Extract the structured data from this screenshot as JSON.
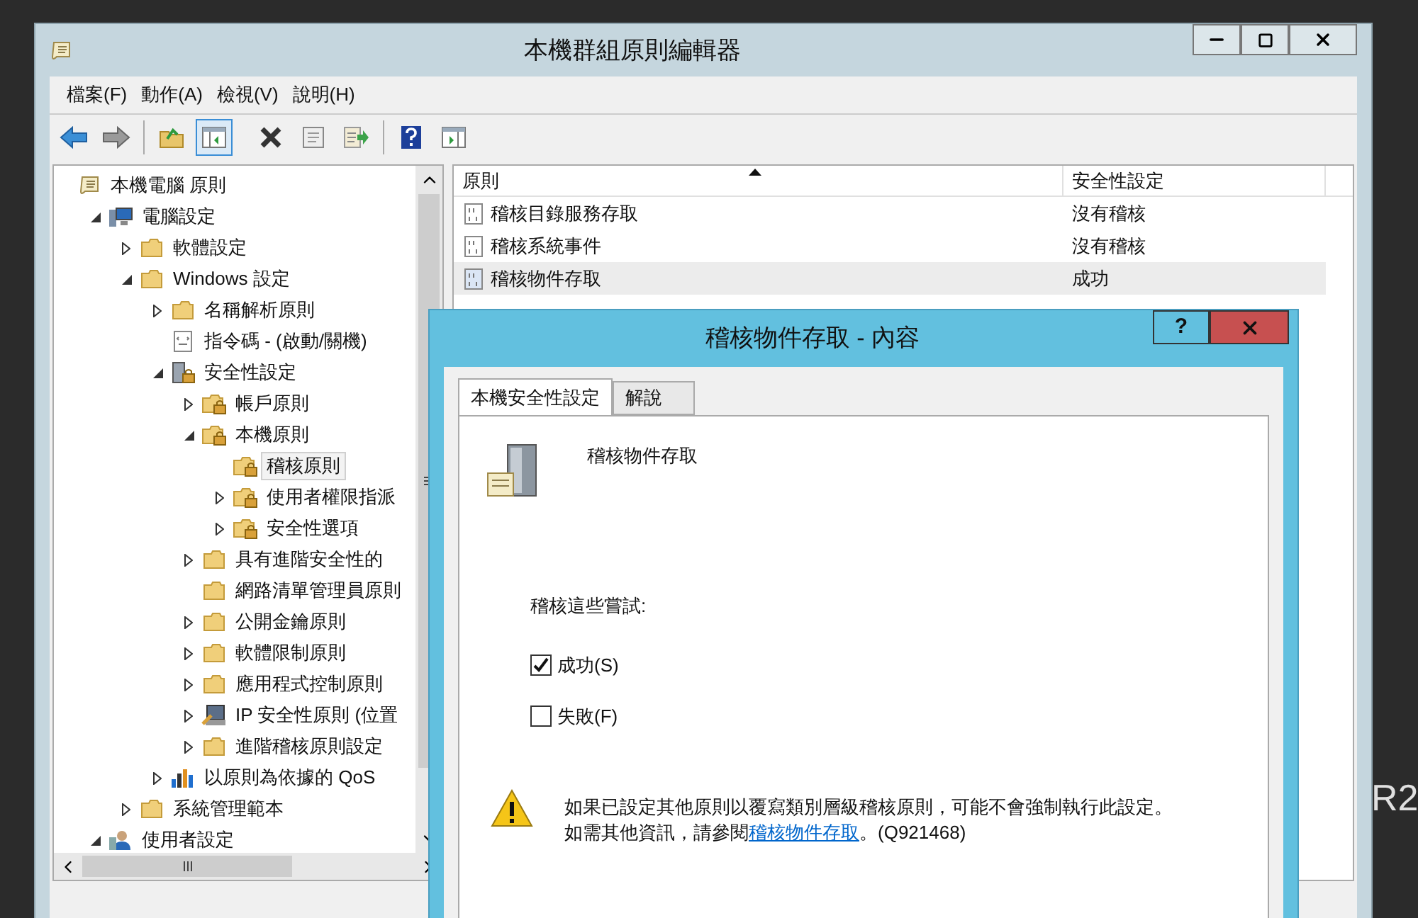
{
  "desktop": {
    "text": "R2"
  },
  "window": {
    "title": "本機群組原則編輯器"
  },
  "menu": [
    "檔案(F)",
    "動作(A)",
    "檢視(V)",
    "說明(H)"
  ],
  "toolbar": [
    {
      "kind": "back",
      "pressed": false
    },
    {
      "kind": "forward",
      "pressed": false
    },
    {
      "kind": "up",
      "pressed": false
    },
    {
      "kind": "tree",
      "pressed": true
    },
    {
      "kind": "delete",
      "pressed": false
    },
    {
      "kind": "properties",
      "pressed": false
    },
    {
      "kind": "export",
      "pressed": false
    },
    {
      "kind": "help",
      "pressed": false
    },
    {
      "kind": "pane",
      "pressed": false
    }
  ],
  "tree": [
    {
      "label": "本機電腦 原則",
      "kind": "policy",
      "selected": false,
      "children": [
        {
          "label": "電腦設定",
          "kind": "computer",
          "expanded": true,
          "selected": false,
          "children": [
            {
              "label": "軟體設定",
              "kind": "folder",
              "expanded": false,
              "selected": false
            },
            {
              "label": "Windows 設定",
              "kind": "folder",
              "expanded": true,
              "selected": false,
              "children": [
                {
                  "label": "名稱解析原則",
                  "kind": "folder",
                  "expanded": false,
                  "selected": false
                },
                {
                  "label": "指令碼 - (啟動/關機)",
                  "kind": "script",
                  "selected": false
                },
                {
                  "label": "安全性設定",
                  "kind": "security",
                  "expanded": true,
                  "selected": false,
                  "children": [
                    {
                      "label": "帳戶原則",
                      "kind": "lockfolder",
                      "expanded": false,
                      "selected": false
                    },
                    {
                      "label": "本機原則",
                      "kind": "lockfolder",
                      "expanded": true,
                      "selected": false,
                      "children": [
                        {
                          "label": "稽核原則",
                          "kind": "lockfolder",
                          "selected": true
                        },
                        {
                          "label": "使用者權限指派",
                          "kind": "lockfolder",
                          "expanded": false,
                          "selected": false
                        },
                        {
                          "label": "安全性選項",
                          "kind": "lockfolder",
                          "expanded": false,
                          "selected": false
                        }
                      ]
                    },
                    {
                      "label": "具有進階安全性的",
                      "kind": "folder",
                      "expanded": false,
                      "selected": false
                    },
                    {
                      "label": "網路清單管理員原則",
                      "kind": "folder",
                      "selected": false
                    },
                    {
                      "label": "公開金鑰原則",
                      "kind": "folder",
                      "expanded": false,
                      "selected": false
                    },
                    {
                      "label": "軟體限制原則",
                      "kind": "folder",
                      "expanded": false,
                      "selected": false
                    },
                    {
                      "label": "應用程式控制原則",
                      "kind": "folder",
                      "expanded": false,
                      "selected": false
                    },
                    {
                      "label": "IP 安全性原則 (位置",
                      "kind": "ip",
                      "expanded": false,
                      "selected": false
                    },
                    {
                      "label": "進階稽核原則設定",
                      "kind": "folder",
                      "expanded": false,
                      "selected": false
                    }
                  ]
                },
                {
                  "label": "以原則為依據的 QoS",
                  "kind": "qos",
                  "expanded": false,
                  "selected": false
                }
              ]
            },
            {
              "label": "系統管理範本",
              "kind": "folder",
              "expanded": false,
              "selected": false
            }
          ]
        },
        {
          "label": "使用者設定",
          "kind": "user",
          "expanded": true,
          "selected": false
        }
      ]
    }
  ],
  "list": {
    "columns": [
      "原則",
      "安全性設定"
    ],
    "rows": [
      {
        "policy": "稽核目錄服務存取",
        "setting": "沒有稽核",
        "selected": false
      },
      {
        "policy": "稽核系統事件",
        "setting": "沒有稽核",
        "selected": false
      },
      {
        "policy": "稽核物件存取",
        "setting": "成功",
        "selected": true
      }
    ]
  },
  "dialog": {
    "title": "稽核物件存取 - 內容",
    "help": "?",
    "tabs": [
      {
        "label": "本機安全性設定",
        "selected": true
      },
      {
        "label": "解說",
        "selected": false
      }
    ],
    "policy_name": "稽核物件存取",
    "group_label": "稽核這些嘗試:",
    "options": [
      {
        "label": "成功(S)",
        "checked": true
      },
      {
        "label": "失敗(F)",
        "checked": false
      }
    ],
    "warning": "如果已設定其他原則以覆寫類別層級稽核原則，可能不會強制執行此設定。",
    "info_prefix": "如需其他資訊，請參閱",
    "info_link": "稽核物件存取",
    "info_suffix": "。(Q921468)"
  }
}
